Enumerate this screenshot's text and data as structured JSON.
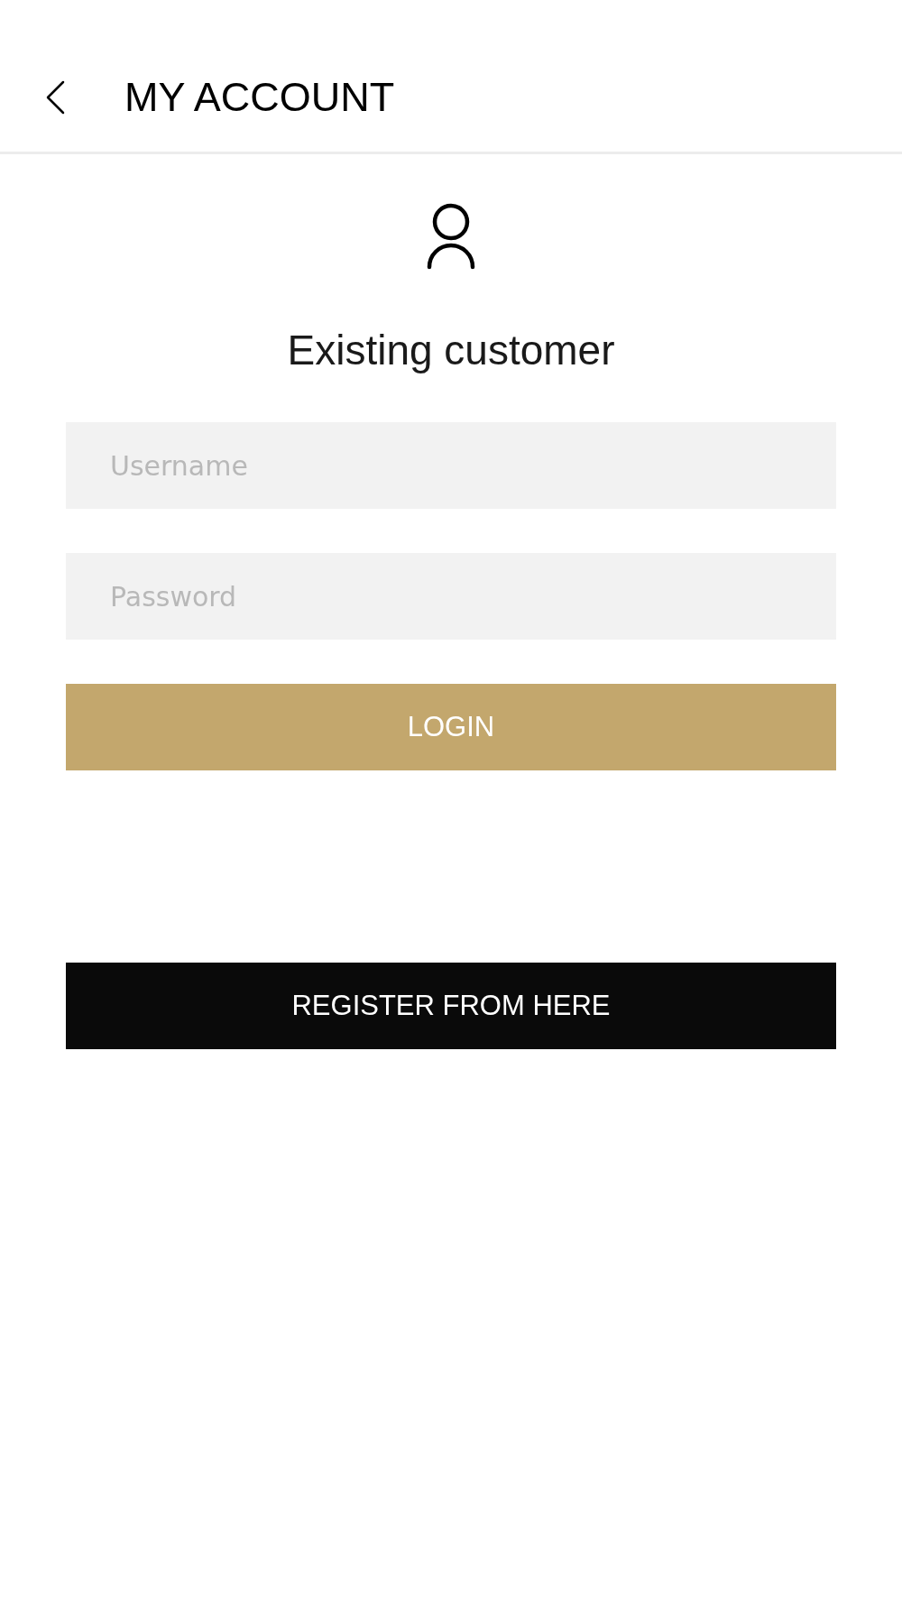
{
  "header": {
    "title": "MY ACCOUNT"
  },
  "login": {
    "heading": "Existing customer",
    "fields": [
      {
        "placeholder": "Username"
      },
      {
        "placeholder": "Password"
      }
    ],
    "button": "LOGIN"
  },
  "register": {
    "button": "REGISTER FROM HERE"
  }
}
